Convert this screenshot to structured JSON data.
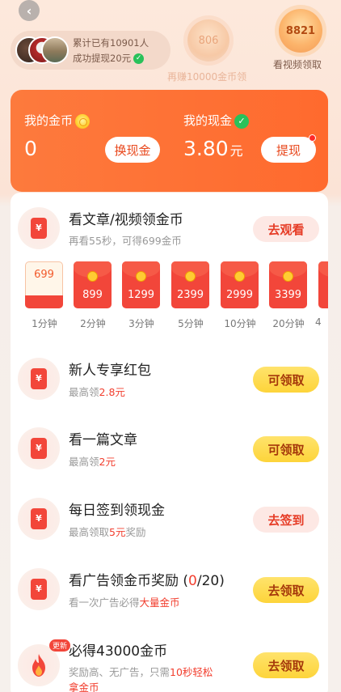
{
  "top": {
    "notice_line1": "累计已有10901人",
    "notice_line2": "成功提现20元",
    "bubble_faded_value": "806",
    "bubble_faded_caption": "再赚10000金币领",
    "bubble_active_value": "8821",
    "bubble_active_caption": "看视频领取"
  },
  "wallet": {
    "coin_label": "我的金币",
    "coin_value": "0",
    "exchange_label": "换现金",
    "cash_label": "我的现金",
    "cash_value": "3.80",
    "cash_unit": "元",
    "withdraw_label": "提现"
  },
  "tasks": {
    "watch": {
      "title": "看文章/视频领金币",
      "subtitle": "再看55秒，可得699金币",
      "button": "去观看",
      "envelopes": [
        {
          "amount": "699",
          "label": "1分钟"
        },
        {
          "amount": "899",
          "label": "2分钟"
        },
        {
          "amount": "1299",
          "label": "3分钟"
        },
        {
          "amount": "2399",
          "label": "5分钟"
        },
        {
          "amount": "2999",
          "label": "10分钟"
        },
        {
          "amount": "3399",
          "label": "20分钟"
        },
        {
          "amount": "",
          "label": "4"
        }
      ]
    },
    "newbie": {
      "title": "新人专享红包",
      "sub_prefix": "最高领",
      "sub_highlight": "2.8元",
      "button": "可领取"
    },
    "article": {
      "title": "看一篇文章",
      "sub_prefix": "最高领",
      "sub_highlight": "2元",
      "button": "可领取"
    },
    "checkin": {
      "title": "每日签到领现金",
      "sub_prefix": "最高领取",
      "sub_highlight": "5元",
      "sub_suffix": "奖励",
      "button": "去签到"
    },
    "ads": {
      "title_prefix": "看广告领金币奖励 (",
      "title_count": "0",
      "title_suffix": "/20)",
      "sub_prefix": "看一次广告必得",
      "sub_highlight": "大量金币",
      "button": "去领取"
    },
    "bonus": {
      "badge": "更新",
      "title": "必得43000金币",
      "sub_prefix": "奖励高、无广告，只需",
      "sub_highlight": "10秒轻松",
      "sub_line2": "拿金币",
      "button": "去领取"
    }
  },
  "colors": {
    "accent": "#ff6a2e",
    "highlight": "#f23e2e",
    "button_yellow": "#fdd43a"
  }
}
